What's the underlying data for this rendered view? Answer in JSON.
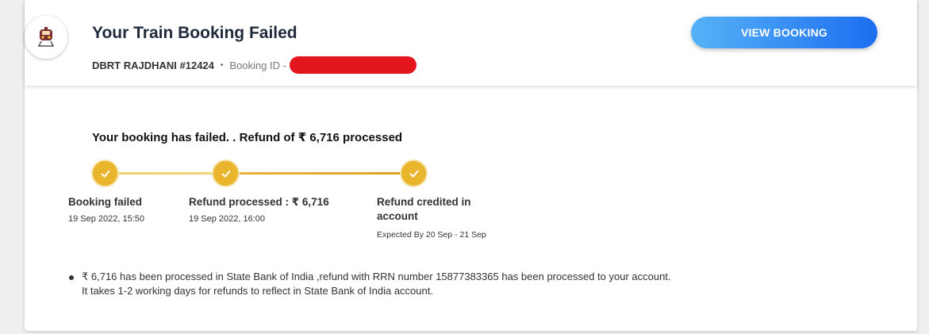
{
  "header": {
    "title": "Your Train Booking Failed",
    "train_name": "DBRT RAJDHANI #12424",
    "separator": "•",
    "booking_id_label": "Booking ID -",
    "view_button_label": "VIEW BOOKING"
  },
  "status": {
    "title": "Your booking has failed. . Refund of ₹ 6,716 processed"
  },
  "steps": [
    {
      "label": "Booking failed",
      "date": "19 Sep 2022, 15:50"
    },
    {
      "label": "Refund processed : ₹ 6,716",
      "date": "19 Sep 2022, 16:00"
    },
    {
      "label": "Refund credited in account",
      "expected": "Expected By 20 Sep - 21 Sep"
    }
  ],
  "note": {
    "line1": "₹ 6,716 has been processed in State Bank of India ,refund with RRN number 15877383365 has been processed to your account.",
    "line2": "It takes 1-2 working days for refunds to reflect in State Bank of India account."
  },
  "colors": {
    "accent_gold": "#e9b52c",
    "button_gradient_start": "#56b2f6",
    "button_gradient_end": "#1c6ef0",
    "redaction": "#e4161d"
  },
  "icons": {
    "train": "train-icon",
    "check": "check-icon"
  }
}
